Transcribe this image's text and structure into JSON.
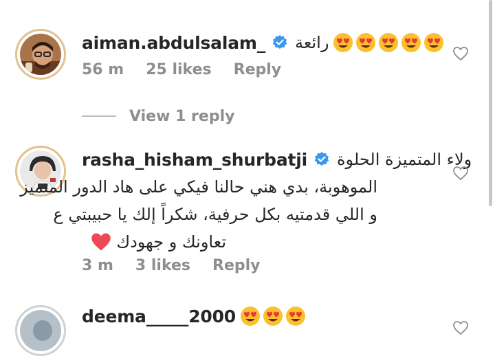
{
  "comments": [
    {
      "username": "aiman.abdulsalam_",
      "text": "رائعة",
      "emoji_count": 5,
      "time": "56 m",
      "likes": "25 likes",
      "reply": "Reply"
    },
    {
      "username": "rasha_hisham_shurbatji",
      "text_line1": "ولاء المتميزة الحلوة",
      "text_line2": "الموهوبة، بدي هني حالنا فيكي على هاد الدور المتميز",
      "text_line3": "و اللي قدمتيه بكل حرفية، شكراً إلك يا حبيبتي ع",
      "text_line4": "تعاونك و جهودك",
      "time": "3 m",
      "likes": "3 likes",
      "reply": "Reply"
    },
    {
      "username": "deema_____2000",
      "emoji_count": 3
    }
  ],
  "view_reply": "View 1 reply",
  "colors": {
    "text": "#262626",
    "meta": "#8e8e8e",
    "verified": "#3897f0",
    "heart": "#ed4956",
    "emoji_face": "#fbc02d"
  },
  "icons": {
    "verified": "verified-badge-icon",
    "like": "heart-outline-icon",
    "emoji": "heart-eyes-emoji",
    "red_heart": "red-heart-emoji"
  }
}
